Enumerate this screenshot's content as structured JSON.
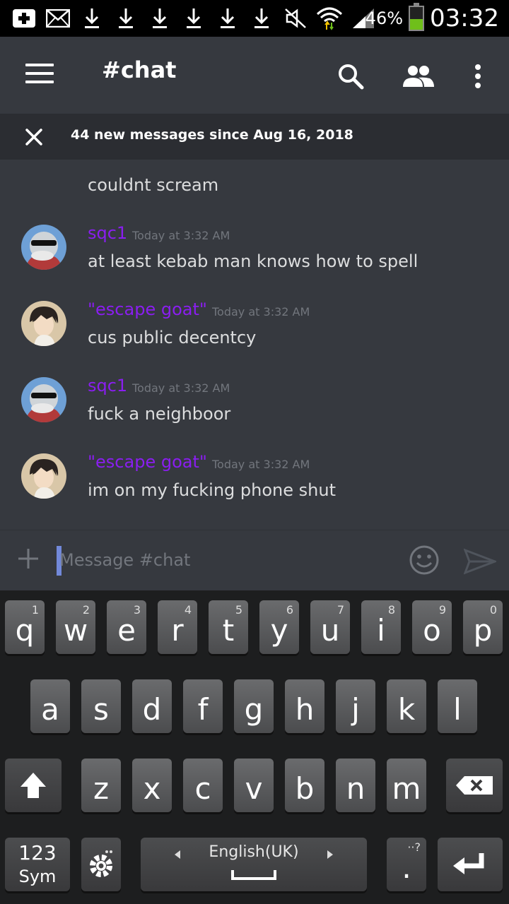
{
  "status_bar": {
    "battery_percent": "46%",
    "battery_level": 0.46,
    "time": "03:32",
    "icons": [
      "add-box-icon",
      "mail-icon",
      "download-icon",
      "download-icon",
      "download-icon",
      "download-icon",
      "download-icon",
      "download-icon",
      "mute-icon",
      "wifi-icon",
      "signal-icon"
    ]
  },
  "header": {
    "title": "#chat",
    "icons": [
      "menu-icon",
      "search-icon",
      "members-icon",
      "more-icon"
    ]
  },
  "banner": {
    "text": "44 new messages since Aug 16, 2018"
  },
  "messages": {
    "partial_text": "couldnt scream",
    "items": [
      {
        "author": "sqc1",
        "timestamp": "Today at 3:32 AM",
        "text": "at least kebab man knows how to spell"
      },
      {
        "author": "\"escape goat\"",
        "timestamp": "Today at 3:32 AM",
        "text": "cus public decentcy"
      },
      {
        "author": "sqc1",
        "timestamp": "Today at 3:32 AM",
        "text": "fuck a neighboor"
      },
      {
        "author": "\"escape goat\"",
        "timestamp": "Today at 3:32 AM",
        "text": "im on my fucking phone shut"
      }
    ]
  },
  "input": {
    "placeholder": "Message #chat",
    "value": ""
  },
  "keyboard": {
    "row1": [
      {
        "key": "q",
        "hint": "1"
      },
      {
        "key": "w",
        "hint": "2"
      },
      {
        "key": "e",
        "hint": "3"
      },
      {
        "key": "r",
        "hint": "4"
      },
      {
        "key": "t",
        "hint": "5"
      },
      {
        "key": "y",
        "hint": "6"
      },
      {
        "key": "u",
        "hint": "7"
      },
      {
        "key": "i",
        "hint": "8"
      },
      {
        "key": "o",
        "hint": "9"
      },
      {
        "key": "p",
        "hint": "0"
      }
    ],
    "row2": [
      "a",
      "s",
      "d",
      "f",
      "g",
      "h",
      "j",
      "k",
      "l"
    ],
    "row3": [
      "z",
      "x",
      "c",
      "v",
      "b",
      "n",
      "m"
    ],
    "sym_top": "123",
    "sym_bottom": "Sym",
    "space_label": "English(UK)",
    "period": ".",
    "period_hint": "··?"
  }
}
